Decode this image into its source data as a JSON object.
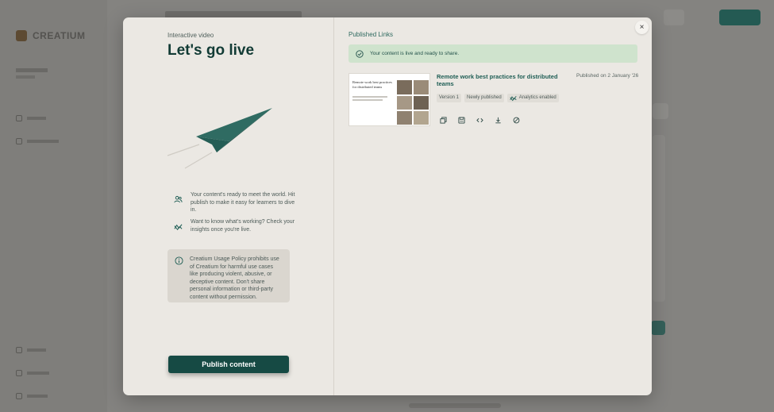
{
  "background": {
    "brand": "CREATIUM",
    "colors": {
      "overlay": "#848380",
      "accent": "#164a44"
    }
  },
  "modal": {
    "left": {
      "eyebrow": "Interactive video",
      "title": "Let's go live",
      "illustration": "paper-plane-icon",
      "info": [
        {
          "icon": "learners-icon",
          "text": "Your content's ready to meet the world. Hit publish to make it easy for learners to dive in."
        },
        {
          "icon": "insights-icon",
          "text": "Want to know what's working? Check your insights once you're live."
        }
      ],
      "policy": {
        "icon": "info-circle-icon",
        "text": "Creatium Usage Policy prohibits use of Creatium for harmful use cases like producing violent, abusive, or deceptive content. Don't share personal information or third-party content without permission."
      },
      "publish_label": "Publish content"
    },
    "right": {
      "heading": "Published Links",
      "success_message": "Your content is live and ready to share.",
      "card": {
        "title": "Remote work best practices for distributed teams",
        "thumbnail_title": "Remote work best practices for distributed teams",
        "published": "Published on 2 January '26",
        "badges": [
          "Version 1",
          "Newly published",
          "Analytics enabled"
        ],
        "actions": [
          "copy-icon",
          "save-icon",
          "embed-icon",
          "download-icon",
          "disable-icon"
        ]
      }
    },
    "close_icon": "×"
  },
  "colors": {
    "success_bg": "#cfe3cd",
    "primary_button": "#164a44",
    "title": "#123b35",
    "link_title": "#1f5e55"
  }
}
